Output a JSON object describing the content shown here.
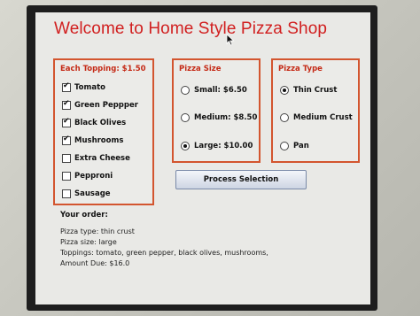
{
  "window": {
    "title": "Welcome to Home Style Pizza Shop"
  },
  "toppings": {
    "title": "Each Topping: $1.50",
    "items": [
      {
        "label": "Tomato",
        "checked": true
      },
      {
        "label": "Green Peppper",
        "checked": true
      },
      {
        "label": "Black Olives",
        "checked": true
      },
      {
        "label": "Mushrooms",
        "checked": true
      },
      {
        "label": "Extra Cheese",
        "checked": false
      },
      {
        "label": "Pepproni",
        "checked": false
      },
      {
        "label": "Sausage",
        "checked": false
      }
    ]
  },
  "size": {
    "title": "Pizza Size",
    "options": [
      {
        "label": "Small: $6.50",
        "selected": false
      },
      {
        "label": "Medium: $8.50",
        "selected": false
      },
      {
        "label": "Large: $10.00",
        "selected": true
      }
    ]
  },
  "type": {
    "title": "Pizza Type",
    "options": [
      {
        "label": "Thin Crust",
        "selected": true
      },
      {
        "label": "Medium Crust",
        "selected": false
      },
      {
        "label": "Pan",
        "selected": false
      }
    ]
  },
  "process_button": {
    "label": "Process Selection"
  },
  "order": {
    "heading": "Your order:",
    "lines": [
      "Pizza type: thin crust",
      "Pizza size: large",
      "Toppings: tomato, green pepper, black olives, mushrooms,",
      "Amount Due: $16.0"
    ]
  },
  "colors": {
    "title": "#d11f1f",
    "panel_border": "#d3552f",
    "window_bg": "#e9e9e6"
  }
}
